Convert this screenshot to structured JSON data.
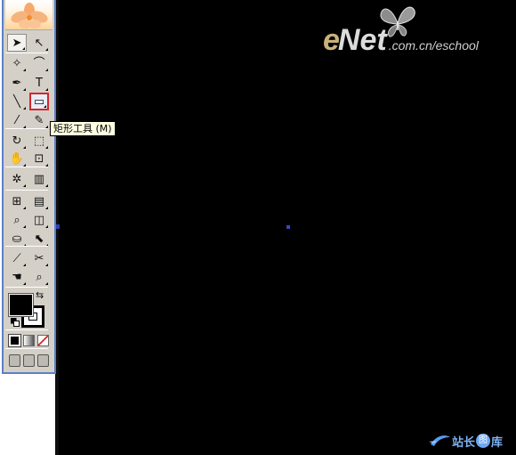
{
  "tooltip": {
    "text": "矩形工具 (M)"
  },
  "watermark": {
    "brand_e": "e",
    "brand_net": "Net",
    "domain": ".com.cn/eschool"
  },
  "site_logo": {
    "part1": "站长",
    "part2": "图",
    "part3": "库"
  },
  "toolbox": {
    "tools": [
      {
        "name": "selection-tool-icon",
        "glyph": "➤",
        "selected": true
      },
      {
        "name": "direct-selection-tool-icon",
        "glyph": "↖"
      },
      {
        "name": "magic-wand-tool-icon",
        "glyph": "✧"
      },
      {
        "name": "lasso-tool-icon",
        "glyph": "⌒"
      },
      {
        "name": "pen-tool-icon",
        "glyph": "✒"
      },
      {
        "name": "type-tool-icon",
        "glyph": "T"
      },
      {
        "name": "line-segment-tool-icon",
        "glyph": "╲"
      },
      {
        "name": "rectangle-tool-icon",
        "glyph": "▭",
        "highlighted": true
      },
      {
        "name": "paintbrush-tool-icon",
        "glyph": "⁄"
      },
      {
        "name": "pencil-tool-icon",
        "glyph": "✎"
      },
      {
        "name": "rotate-tool-icon",
        "glyph": "↻"
      },
      {
        "name": "scale-tool-icon",
        "glyph": "⬚"
      },
      {
        "name": "warp-tool-icon",
        "glyph": "✋"
      },
      {
        "name": "free-transform-tool-icon",
        "glyph": "⊡"
      },
      {
        "name": "symbol-sprayer-tool-icon",
        "glyph": "✲"
      },
      {
        "name": "column-graph-tool-icon",
        "glyph": "▥"
      },
      {
        "name": "mesh-tool-icon",
        "glyph": "⊞"
      },
      {
        "name": "gradient-tool-icon",
        "glyph": "▤"
      },
      {
        "name": "eyedropper-tool-icon",
        "glyph": "⌕"
      },
      {
        "name": "blend-tool-icon",
        "glyph": "◫"
      },
      {
        "name": "live-paint-bucket-tool-icon",
        "glyph": "⛀"
      },
      {
        "name": "live-paint-selection-tool-icon",
        "glyph": "⬉"
      },
      {
        "name": "slice-tool-icon",
        "glyph": "⟋"
      },
      {
        "name": "scissors-tool-icon",
        "glyph": "✂"
      },
      {
        "name": "hand-tool-icon",
        "glyph": "☚"
      },
      {
        "name": "zoom-tool-icon",
        "glyph": "⌕"
      }
    ]
  },
  "colors": {
    "fill": "#000000",
    "stroke": "#000000",
    "artboard": "#000000",
    "toolbox_bg": "#d4d0c8",
    "toolbox_border": "#5c7fc8",
    "highlight_border": "#d3262c"
  }
}
